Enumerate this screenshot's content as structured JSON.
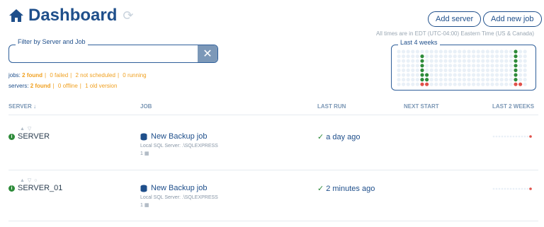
{
  "header": {
    "title": "Dashboard",
    "icons": {
      "home": "home-icon",
      "refresh": "refresh-icon"
    },
    "buttons": {
      "add_server": "Add server",
      "add_job": "Add new job"
    },
    "timezone_note": "All times are in EDT (UTC-04:00) Eastern Time (US & Canada)"
  },
  "filter": {
    "legend": "Filter by Server and Job",
    "value": "",
    "clear_icon": "close-icon"
  },
  "stats": {
    "jobs": {
      "label": "jobs:",
      "found": "2 found",
      "failed": "0 failed",
      "not_scheduled": "2 not scheduled",
      "running": "0 running"
    },
    "servers": {
      "label": "servers:",
      "found": "2 found",
      "offline": "0 offline",
      "old_version": "1 old version"
    }
  },
  "weeks_panel": {
    "legend": "Last 4 weeks"
  },
  "columns": {
    "server": "SERVER",
    "job": "JOB",
    "last_run": "LAST RUN",
    "next_start": "NEXT START",
    "last2": "LAST 2 WEEKS"
  },
  "rows": [
    {
      "server": "SERVER",
      "job": "New Backup job",
      "job_sub": "Local SQL Server: .\\SQLEXPRESS",
      "job_count": "1",
      "last_run": "a day ago",
      "next_start": ""
    },
    {
      "server": "SERVER_01",
      "job": "New Backup job",
      "job_sub": "Local SQL Server: .\\SQLEXPRESS",
      "job_count": "1",
      "last_run": "2 minutes ago",
      "next_start": ""
    }
  ],
  "colors": {
    "brand": "#1f4f8b",
    "success": "#2e8b3a",
    "warning": "#f0a020",
    "fail": "#e0504a",
    "grid_empty": "#e9f0f7"
  }
}
